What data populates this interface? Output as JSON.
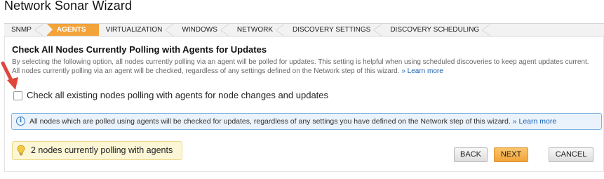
{
  "window": {
    "title": "Network Sonar Wizard"
  },
  "steps": [
    {
      "label": "SNMP"
    },
    {
      "label": "AGENTS"
    },
    {
      "label": "VIRTUALIZATION"
    },
    {
      "label": "WINDOWS"
    },
    {
      "label": "NETWORK"
    },
    {
      "label": "DISCOVERY SETTINGS"
    },
    {
      "label": "DISCOVERY SCHEDULING"
    }
  ],
  "active_step": "AGENTS",
  "main": {
    "heading": "Check All Nodes Currently Polling with Agents for Updates",
    "description": "By selecting the following option, all nodes currently polling via an agent will be polled for updates. This setting is helpful when using scheduled discoveries to keep agent updates current. All nodes currently polling via an agent will be checked, regardless of any settings defined on the Network step of this wizard.",
    "description_link": "» Learn more",
    "checkbox_label": "Check all existing nodes polling with agents for node changes and updates",
    "checkbox_checked": false,
    "info_text": "All nodes which are polled using agents will be checked for updates, regardless of any settings you have defined on the Network step of this wizard.",
    "info_link": "» Learn more",
    "nodes_status": "2 nodes currently polling with agents"
  },
  "buttons": {
    "back": "BACK",
    "next": "NEXT",
    "cancel": "CANCEL"
  },
  "icons": {
    "info": "info-icon",
    "bulb": "lightbulb-icon",
    "arrow": "red-arrow-annotation-icon"
  },
  "colors": {
    "accent": "#f3a33a",
    "link": "#1a62b0",
    "info_bg": "#eaf3fb",
    "note_bg": "#fdf6d6"
  }
}
